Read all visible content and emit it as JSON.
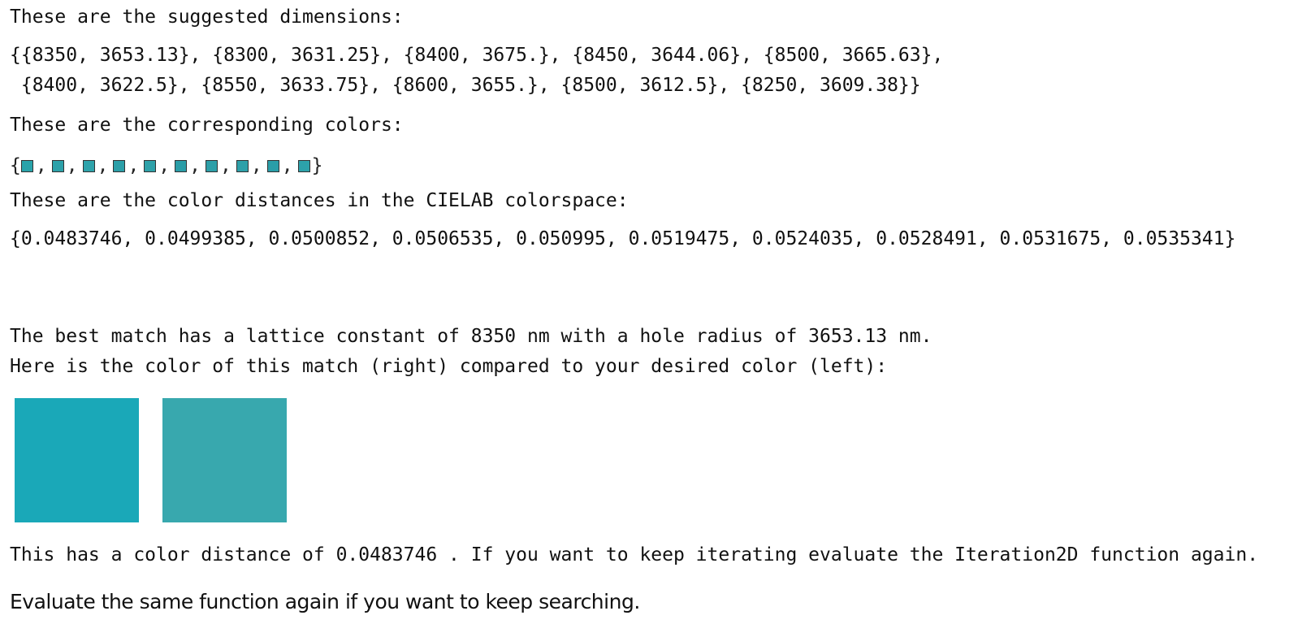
{
  "dimensions_heading": "These are the suggested dimensions:",
  "dimensions_line1": "{{8350, 3653.13}, {8300, 3631.25}, {8400, 3675.}, {8450, 3644.06}, {8500, 3665.63},",
  "dimensions_line2": " {8400, 3622.5}, {8550, 3633.75}, {8600, 3655.}, {8500, 3612.5}, {8250, 3609.38}}",
  "colors_heading": "These are the corresponding colors:",
  "swatches": [
    "#2aa3aa",
    "#2ca1a9",
    "#2ea3ab",
    "#2b9fa8",
    "#2ea1a9",
    "#2a9da7",
    "#2d9fa8",
    "#2ea0a9",
    "#2a9ea8",
    "#2da2aa"
  ],
  "distances_heading": "These are the color distances in the CIELAB colorspace:",
  "distances_line": "{0.0483746, 0.0499385, 0.0500852, 0.0506535, 0.050995, 0.0519475, 0.0524035, 0.0528491, 0.0531675, 0.0535341}",
  "best_match_line": "The best match has a lattice constant of 8350 nm with a hole radius of 3653.13 nm.",
  "comparison_line": "Here is the color of this match (right) compared to your desired color (left):",
  "desired_color": "#1aa8b8",
  "match_color": "#38a8ae",
  "distance_line": "This has a color distance of 0.0483746 . If you want to keep iterating evaluate the Iteration2D function again.",
  "footer_text": "Evaluate the same function again if you want to keep searching."
}
